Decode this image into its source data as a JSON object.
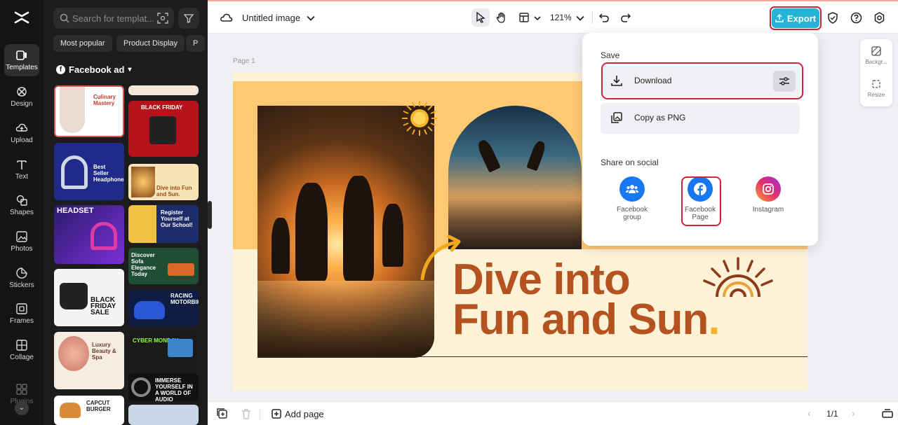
{
  "app": {
    "accent": "#24b4d6",
    "highlight": "#d6203b"
  },
  "rail": {
    "items": [
      {
        "label": "Templates",
        "icon": "templates-icon"
      },
      {
        "label": "Design",
        "icon": "design-icon"
      },
      {
        "label": "Upload",
        "icon": "upload-icon"
      },
      {
        "label": "Text",
        "icon": "text-icon"
      },
      {
        "label": "Shapes",
        "icon": "shapes-icon"
      },
      {
        "label": "Photos",
        "icon": "photos-icon"
      },
      {
        "label": "Stickers",
        "icon": "stickers-icon"
      },
      {
        "label": "Frames",
        "icon": "frames-icon"
      },
      {
        "label": "Collage",
        "icon": "collage-icon"
      },
      {
        "label": "Plugins",
        "icon": "plugins-icon"
      }
    ]
  },
  "panel": {
    "search_placeholder": "Search for templat...",
    "chips": [
      "Most popular",
      "Product Display",
      "P"
    ],
    "category": "Facebook ad",
    "templates": [
      {
        "title": "Culinary Mastery"
      },
      {
        "title": "BLACK FRIDAY"
      },
      {
        "title": "Best Seller Headphone"
      },
      {
        "title": "Dive into Fun and Sun."
      },
      {
        "title": "HEADSET"
      },
      {
        "title": "Register Yourself at Our School!"
      },
      {
        "title": "Discover Sofa Elegance Today"
      },
      {
        "title": "BLACK FRIDAY SALE"
      },
      {
        "title": "RACING MOTORBIKE"
      },
      {
        "title": "Luxury Beauty & Spa"
      },
      {
        "title": "CYBER MONDAY"
      },
      {
        "title": "IMMERSE YOURSELF IN A WORLD OF AUDIO"
      },
      {
        "title": "CAPCUT BURGER"
      }
    ]
  },
  "toolbar": {
    "doc_title": "Untitled image",
    "zoom": "121%",
    "export_label": "Export"
  },
  "canvas": {
    "page_label": "Page 1",
    "headline_line1": "Dive into",
    "headline_line2": "Fun and Sun",
    "headline_dot": "."
  },
  "side_tools": [
    {
      "label": "Backgr..."
    },
    {
      "label": "Resize"
    }
  ],
  "export_menu": {
    "save_title": "Save",
    "download_label": "Download",
    "copy_label": "Copy as PNG",
    "share_title": "Share on social",
    "social": [
      {
        "label_1": "Facebook",
        "label_2": "group",
        "color": "#1877f2"
      },
      {
        "label_1": "Facebook",
        "label_2": "Page",
        "color": "#1877f2"
      },
      {
        "label_1": "Instagram",
        "label_2": "",
        "color": "#e1306c"
      }
    ]
  },
  "bottom": {
    "add_page": "Add page",
    "pager": "1/1"
  }
}
